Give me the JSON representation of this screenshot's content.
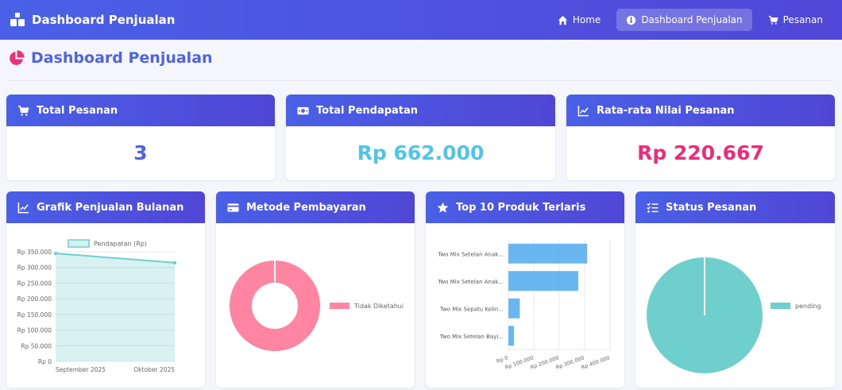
{
  "navbar": {
    "brand": "Dashboard Penjualan",
    "links": [
      {
        "label": "Home",
        "icon": "home-icon"
      },
      {
        "label": "Dashboard Penjualan",
        "icon": "dashboard-icon",
        "active": true
      },
      {
        "label": "Pesanan",
        "icon": "cart-icon"
      }
    ]
  },
  "page": {
    "title": "Dashboard Penjualan"
  },
  "stats": [
    {
      "title": "Total Pesanan",
      "value": "3",
      "color": "#4e63e6",
      "icon": "cart-icon"
    },
    {
      "title": "Total Pendapatan",
      "value": "Rp 662.000",
      "color": "#4fc6e8",
      "icon": "money-icon"
    },
    {
      "title": "Rata-rata Nilai Pesanan",
      "value": "Rp 220.667",
      "color": "#ee2a7b",
      "icon": "line-chart-icon"
    }
  ],
  "panels": {
    "monthly": {
      "title": "Grafik Penjualan Bulanan",
      "icon": "line-chart-icon"
    },
    "payment": {
      "title": "Metode Pembayaran",
      "icon": "credit-card-icon"
    },
    "top": {
      "title": "Top 10 Produk Terlaris",
      "icon": "star-icon"
    },
    "status": {
      "title": "Status Pesanan",
      "icon": "list-check-icon"
    }
  },
  "colors": {
    "accent": "#4e63e6",
    "teal": "#6fcfcc",
    "pink": "#ff85a2",
    "blue": "#5aaef0"
  },
  "chart_data": [
    {
      "type": "line",
      "x": [
        "September 2025",
        "Oktober 2025"
      ],
      "series": [
        {
          "name": "Pendapatan (Rp)",
          "values": [
            345000,
            315000
          ]
        }
      ],
      "yticks": [
        "Rp 0",
        "Rp 50.000",
        "Rp 100.000",
        "Rp 150.000",
        "Rp 200.000",
        "Rp 250.000",
        "Rp 300.000",
        "Rp 350.000"
      ],
      "ylim": [
        0,
        350000
      ],
      "legend": "top",
      "fill": true
    },
    {
      "type": "pie",
      "variant": "doughnut",
      "labels": [
        "Tidak Diketahui"
      ],
      "values": [
        3
      ],
      "legend": "right"
    },
    {
      "type": "bar",
      "orientation": "horizontal",
      "categories": [
        "Two Mix Setelan Anak...",
        "Two Mix Setelan Anak...",
        "Two Mix Sepatu Kelin...",
        "Two Mix Setelan Bayi..."
      ],
      "values": [
        310000,
        275000,
        45000,
        22000
      ],
      "xticks": [
        "Rp 0",
        "Rp 100.000",
        "Rp 200.000",
        "Rp 300.000",
        "Rp 400.000"
      ],
      "xlim": [
        0,
        400000
      ]
    },
    {
      "type": "pie",
      "labels": [
        "pending"
      ],
      "values": [
        3
      ],
      "legend": "right"
    }
  ]
}
